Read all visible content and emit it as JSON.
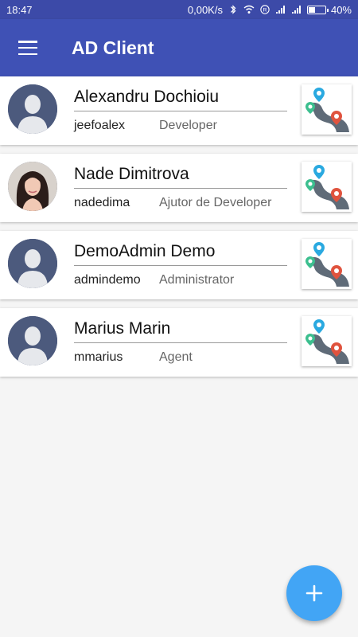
{
  "status_bar": {
    "time": "18:47",
    "network_speed": "0,00K/s",
    "battery_level": "40%",
    "icons": [
      "bluetooth-icon",
      "wifi-icon",
      "registered-icon",
      "signal-icon",
      "signal-icon",
      "battery-icon"
    ]
  },
  "app_bar": {
    "title": "AD Client",
    "menu_icon": "hamburger-menu-icon"
  },
  "users": [
    {
      "name": "Alexandru Dochioiu",
      "username": "jeefoalex",
      "role": "Developer",
      "avatar": "default-avatar",
      "map_icon": "route-map-icon"
    },
    {
      "name": "Nade Dimitrova",
      "username": "nadedima",
      "role": "Ajutor de Developer",
      "avatar": "photo-avatar",
      "map_icon": "route-map-icon"
    },
    {
      "name": "DemoAdmin Demo",
      "username": "admindemo",
      "role": "Administrator",
      "avatar": "default-avatar",
      "map_icon": "route-map-icon"
    },
    {
      "name": "Marius Marin",
      "username": "mmarius",
      "role": "Agent",
      "avatar": "default-avatar",
      "map_icon": "route-map-icon"
    }
  ],
  "fab": {
    "icon": "plus-icon"
  },
  "colors": {
    "status_bar": "#3c4aa8",
    "app_bar": "#3f51b5",
    "fab": "#42a5f5",
    "avatar_bg": "#4c5a7d",
    "pin_blue": "#2aa9e0",
    "pin_green": "#3cbf8f",
    "pin_red": "#e0533e"
  }
}
